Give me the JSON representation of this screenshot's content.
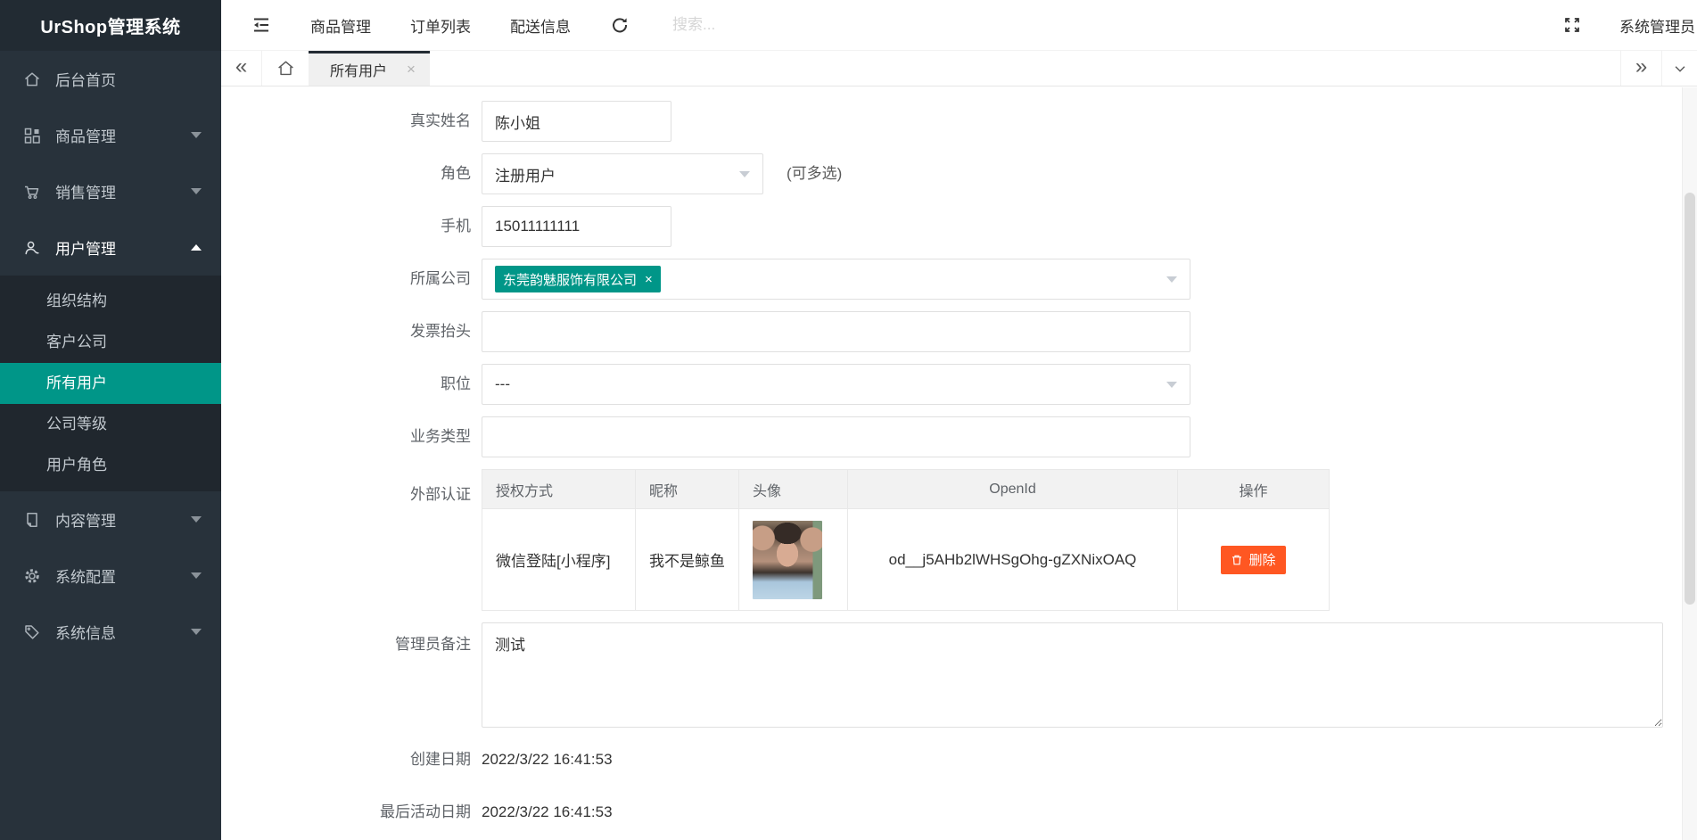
{
  "app": {
    "logo_title": "UrShop管理系统"
  },
  "colors": {
    "accent": "#009688",
    "danger": "#ff5722",
    "sidebar": "#28323b",
    "sidebar_active": "#009688"
  },
  "header": {
    "nav_items": [
      {
        "label": "商品管理"
      },
      {
        "label": "订单列表"
      },
      {
        "label": "配送信息"
      }
    ],
    "search_placeholder": "搜索...",
    "username": "系统管理员"
  },
  "tabbar": {
    "collapse_left": "«",
    "collapse_right": "»",
    "active_tab": {
      "label": "所有用户",
      "close": "×"
    }
  },
  "sidebar": {
    "items": [
      {
        "label": "后台首页",
        "icon": "home-icon"
      },
      {
        "label": "商品管理",
        "icon": "grid-icon"
      },
      {
        "label": "销售管理",
        "icon": "cart-icon"
      },
      {
        "label": "用户管理",
        "icon": "user-icon"
      },
      {
        "label": "内容管理",
        "icon": "document-icon"
      },
      {
        "label": "系统配置",
        "icon": "gear-icon"
      },
      {
        "label": "系统信息",
        "icon": "tag-icon"
      }
    ],
    "user_submenu": [
      {
        "label": "组织结构"
      },
      {
        "label": "客户公司"
      },
      {
        "label": "所有用户",
        "active": true
      },
      {
        "label": "公司等级"
      },
      {
        "label": "用户角色"
      }
    ]
  },
  "form": {
    "real_name": {
      "label": "真实姓名",
      "value": "陈小姐"
    },
    "role": {
      "label": "角色",
      "value": "注册用户",
      "hint": "(可多选)"
    },
    "phone": {
      "label": "手机",
      "value": "15011111111"
    },
    "company": {
      "label": "所属公司",
      "tag": "东莞韵魅服饰有限公司",
      "tag_close": "×"
    },
    "invoice": {
      "label": "发票抬头",
      "value": ""
    },
    "position": {
      "label": "职位",
      "value": "---"
    },
    "business_type": {
      "label": "业务类型",
      "value": ""
    },
    "external_auth": {
      "label": "外部认证",
      "headers": [
        "授权方式",
        "昵称",
        "头像",
        "OpenId",
        "操作"
      ],
      "row": {
        "auth_method": "微信登陆[小程序]",
        "nickname": "我不是鲸鱼",
        "open_id": "od__j5AHb2lWHSgOhg-gZXNixOAQ",
        "delete_label": "删除"
      }
    },
    "admin_remark": {
      "label": "管理员备注",
      "value": "测试"
    },
    "created_date": {
      "label": "创建日期",
      "value": "2022/3/22 16:41:53"
    },
    "last_active_date": {
      "label": "最后活动日期",
      "value": "2022/3/22 16:41:53"
    }
  }
}
